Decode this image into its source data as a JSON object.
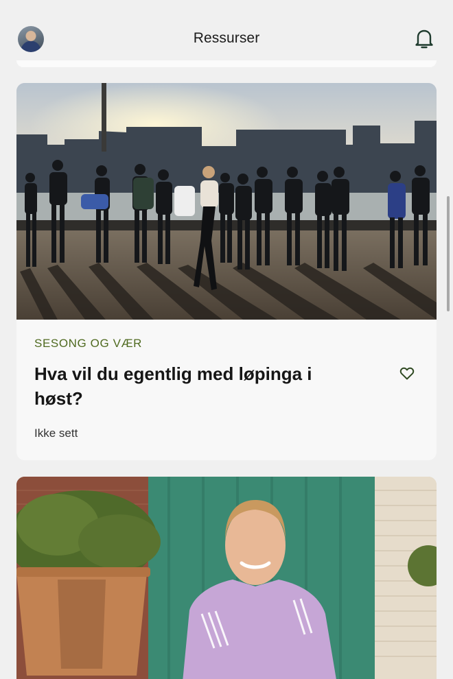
{
  "header": {
    "title": "Ressurser",
    "avatar_icon": "user-avatar",
    "bell_icon": "notification-bell-icon"
  },
  "cards": [
    {
      "category": "SESONG OG VÆR",
      "title": "Hva vil du egentlig med løpinga i høst?",
      "status": "Ikke sett",
      "favorite_icon": "heart-outline-icon",
      "image": "group-of-runners-at-harbour-sunset"
    },
    {
      "image": "smiling-woman-in-purple-running-top-by-green-door"
    }
  ],
  "colors": {
    "background": "#f0f0f0",
    "card": "#f8f8f8",
    "accent_green": "#4f6a20",
    "icon_dark_green": "#1f3b2e"
  }
}
